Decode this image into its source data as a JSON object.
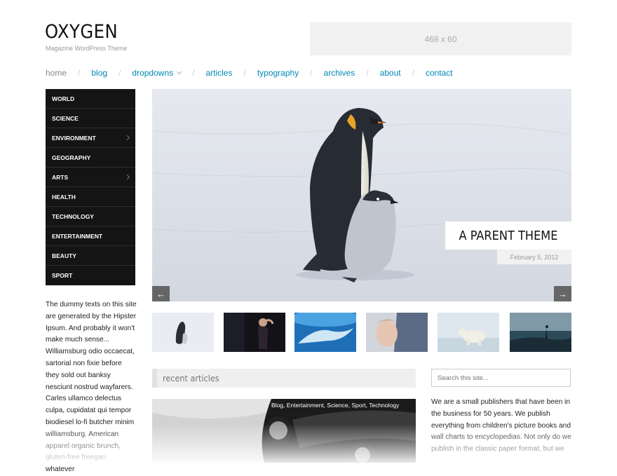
{
  "site": {
    "title": "OXYGEN",
    "tagline": "Magazine WordPress Theme",
    "ad_label": "468 x 60"
  },
  "nav": {
    "items": [
      {
        "label": "home",
        "active": true
      },
      {
        "label": "blog"
      },
      {
        "label": "dropdowns",
        "dropdown": true
      },
      {
        "label": "articles"
      },
      {
        "label": "typography"
      },
      {
        "label": "archives"
      },
      {
        "label": "about"
      },
      {
        "label": "contact"
      }
    ],
    "separator": "/"
  },
  "categories": [
    {
      "label": "WORLD"
    },
    {
      "label": "SCIENCE"
    },
    {
      "label": "ENVIRONMENT",
      "has_submenu": true
    },
    {
      "label": "GEOGRAPHY"
    },
    {
      "label": "ARTS",
      "has_submenu": true
    },
    {
      "label": "HEALTH"
    },
    {
      "label": "TECHNOLOGY"
    },
    {
      "label": "ENTERTAINMENT"
    },
    {
      "label": "BEAUTY"
    },
    {
      "label": "SPORT"
    }
  ],
  "sidebar_text": "The dummy texts on this site are generated by the Hipster Ipsum. And probably it won't make much sense... Williamsburg odio occaecat, sartorial non fixie before they sold out banksy nesciunt nostrud wayfarers. Carles ullamco delectus culpa, cupidatat qui tempor biodiesel lo-fi butcher minim williamsburg. American apparel organic brunch, gluten-free freegan whatever",
  "slider": {
    "caption": "A PARENT THEME",
    "date": "February 5, 2012",
    "prev_icon": "arrow-left-icon",
    "next_icon": "arrow-right-icon",
    "prev_glyph": "←",
    "next_glyph": "→"
  },
  "recent": {
    "heading": "recent articles",
    "tags": "Blog, Entertainment, Science, Sport, Technology"
  },
  "search": {
    "placeholder": "Search this site..."
  },
  "about_text": "We are a small publishers that have been in the business for 50 years. We publish everything from children's picture books and wall charts to encyclopedias. Not only do we publish in the classic paper format, but we"
}
